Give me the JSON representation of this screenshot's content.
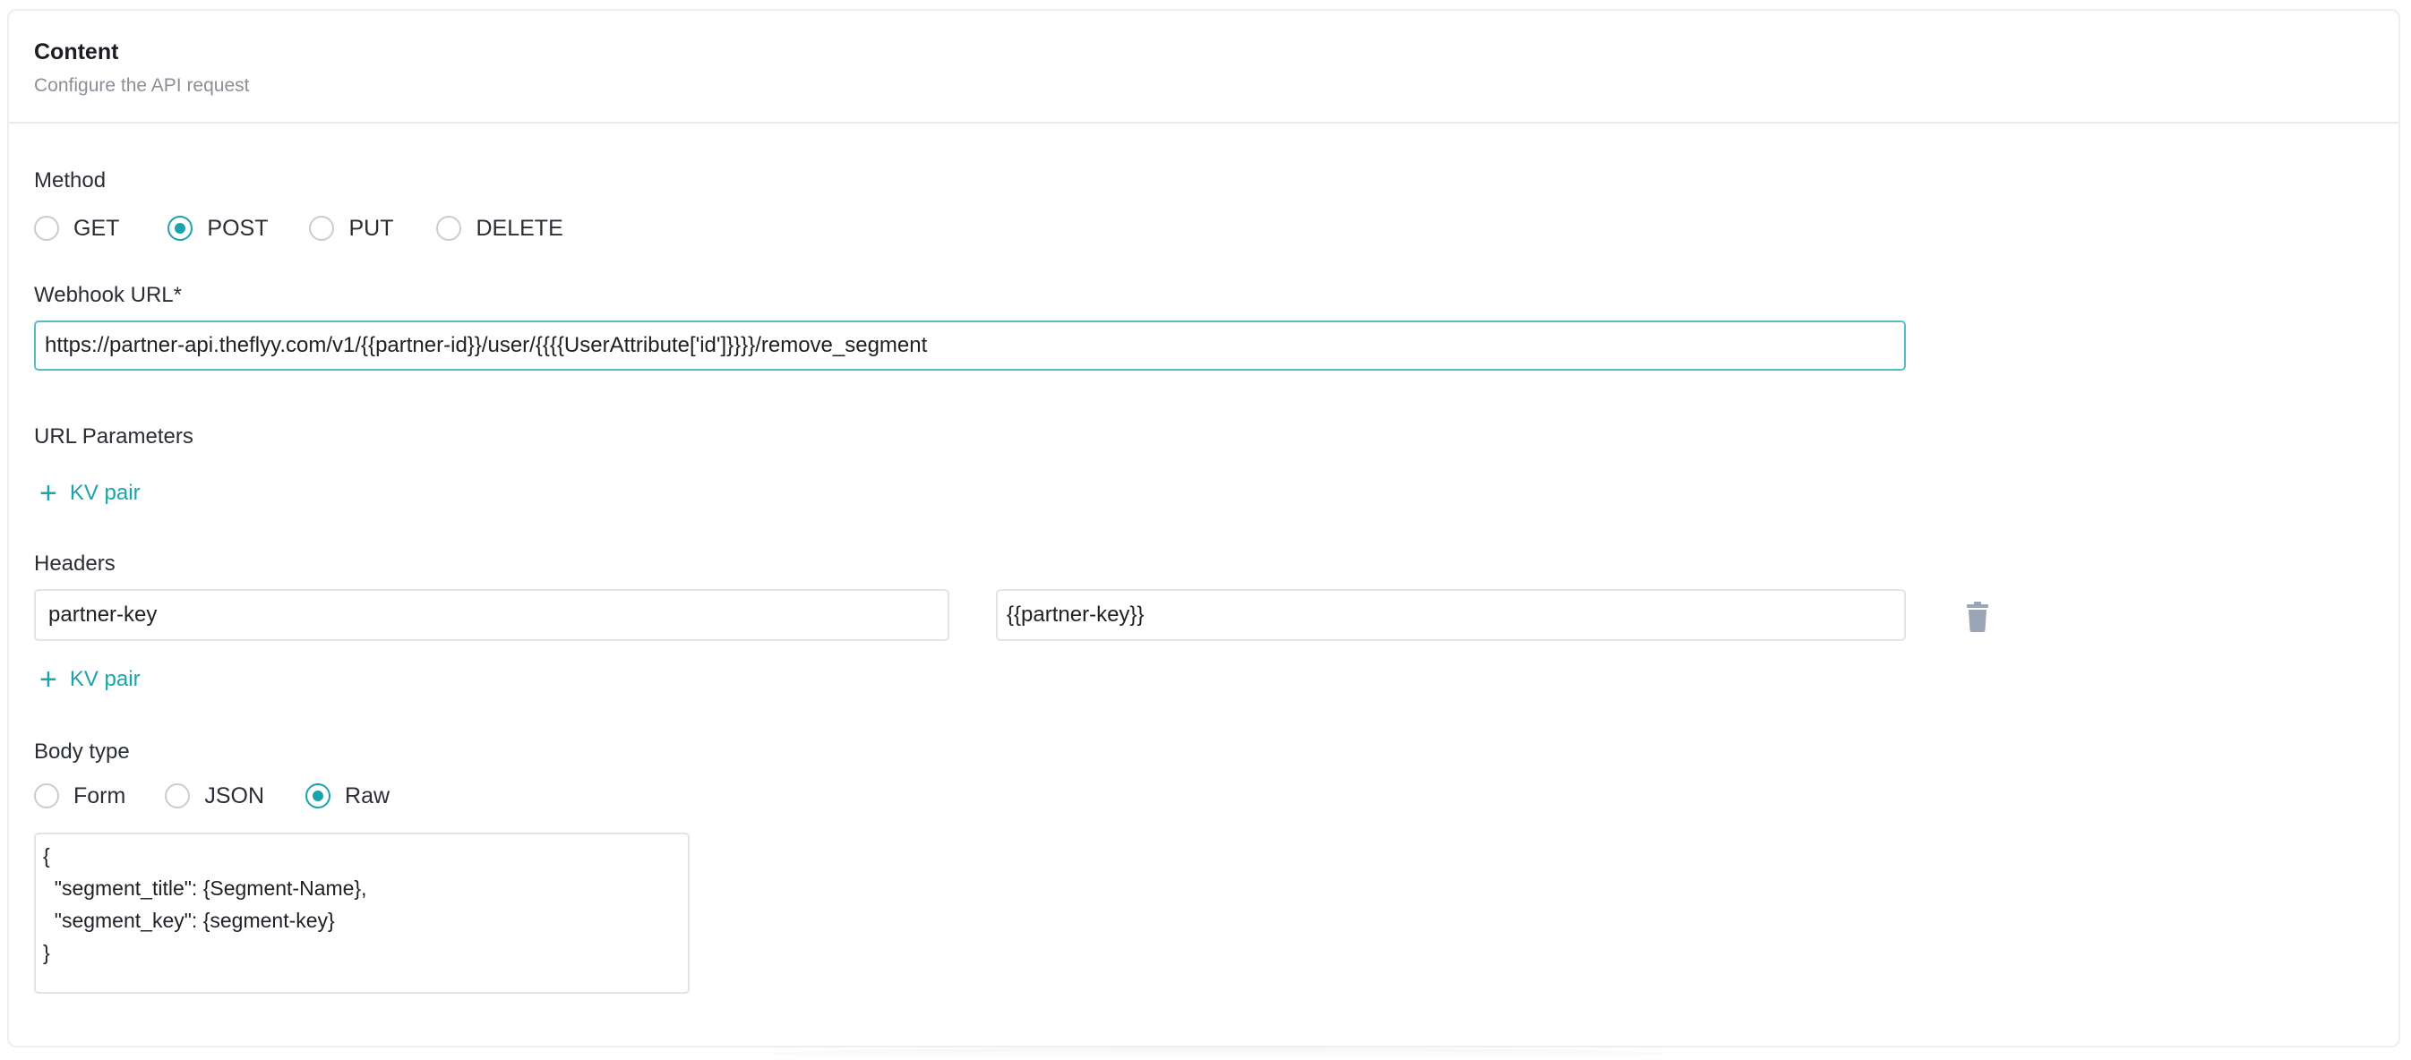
{
  "header": {
    "title": "Content",
    "subtitle": "Configure the API request"
  },
  "method": {
    "label": "Method",
    "options": [
      "GET",
      "POST",
      "PUT",
      "DELETE"
    ],
    "selected": "POST"
  },
  "webhook": {
    "label": "Webhook URL*",
    "value": "https://partner-api.theflyy.com/v1/{{partner-id}}/user/{{{{UserAttribute['id']}}}}/remove_segment"
  },
  "url_parameters": {
    "label": "URL Parameters",
    "add_label": "KV pair"
  },
  "headers": {
    "label": "Headers",
    "rows": [
      {
        "key": "partner-key",
        "value": "{{partner-key}}"
      }
    ],
    "add_label": "KV pair"
  },
  "body_type": {
    "label": "Body type",
    "options": [
      "Form",
      "JSON",
      "Raw"
    ],
    "selected": "Raw",
    "content": "{\n  \"segment_title\": {Segment-Name},\n  \"segment_key\": {segment-key}\n}"
  },
  "icons": {
    "add": "plus-icon",
    "delete": "trash-icon"
  },
  "colors": {
    "accent": "#1aa3ad",
    "trash": "#9aa6b8"
  }
}
